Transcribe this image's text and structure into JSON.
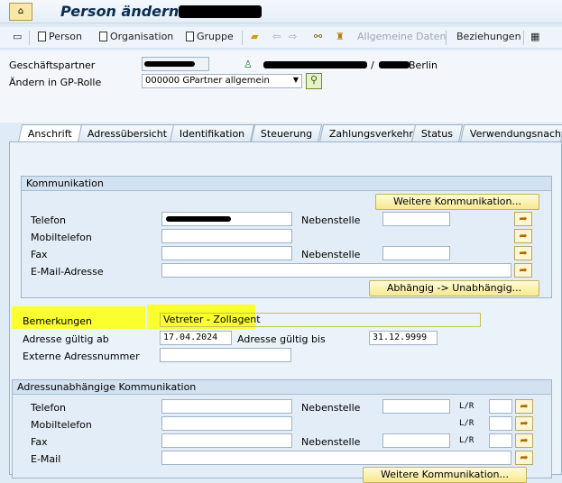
{
  "window": {
    "title": "Person ändern:"
  },
  "toolbar": {
    "person": "Person",
    "organisation": "Organisation",
    "gruppe": "Gruppe",
    "allgemeine_daten": "Allgemeine Daten",
    "beziehungen": "Beziehungen"
  },
  "header": {
    "gp_label": "Geschäftspartner",
    "gp_desc_suffix": "Berlin",
    "rolle_label": "Ändern in GP-Rolle",
    "rolle_value": "000000 GPartner allgemein"
  },
  "tabs": [
    "Anschrift",
    "Adressübersicht",
    "Identifikation",
    "Steuerung",
    "Zahlungsverkehr",
    "Status",
    "Verwendungsnachwe"
  ],
  "komm": {
    "title": "Kommunikation",
    "weitere_button": "Weitere Kommunikation...",
    "telefon": "Telefon",
    "mobil": "Mobiltelefon",
    "fax": "Fax",
    "email": "E-Mail-Adresse",
    "nebenstelle": "Nebenstelle",
    "abh_button": "Abhängig -> Unabhängig..."
  },
  "bemerkungen": {
    "label": "Bemerkungen",
    "value": "Vetreter - Zollagent"
  },
  "gueltig": {
    "ab_label": "Adresse gültig ab",
    "ab_value": "17.04.2024",
    "bis_label": "Adresse gültig bis",
    "bis_value": "31.12.9999"
  },
  "ext_nr_label": "Externe Adressnummer",
  "unabh": {
    "title": "Adressunabhängige Kommunikation",
    "telefon": "Telefon",
    "mobil": "Mobiltelefon",
    "fax": "Fax",
    "email": "E-Mail",
    "nebenstelle": "Nebenstelle",
    "lr": "L/R",
    "weitere_button": "Weitere Kommunikation..."
  },
  "colors": {
    "highlight": "#fbff2e",
    "accent": "#0b2d4f"
  }
}
